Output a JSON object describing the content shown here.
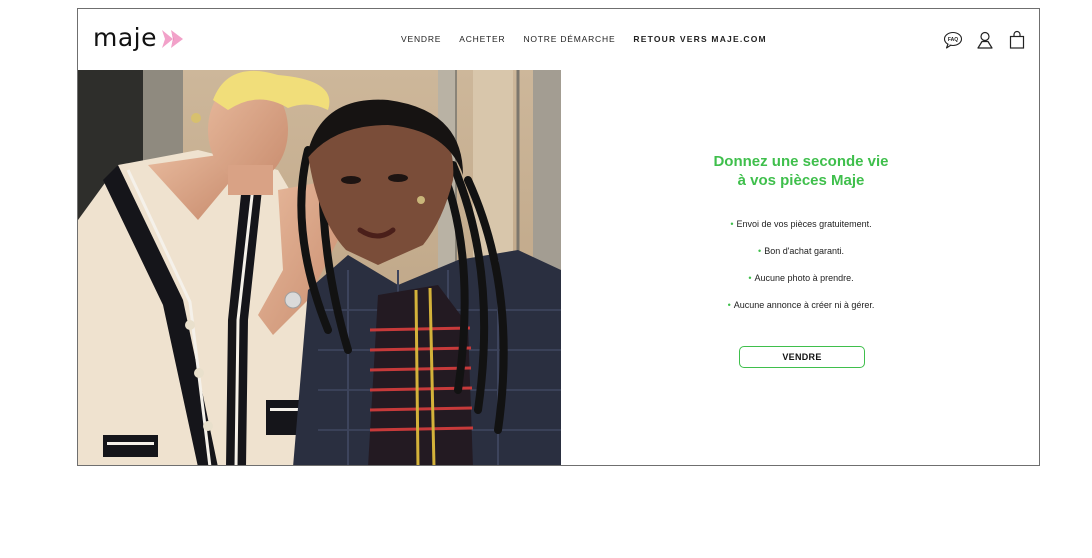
{
  "brand": {
    "name": "maje",
    "accent": "#f2a1c9"
  },
  "nav": [
    {
      "label": "VENDRE"
    },
    {
      "label": "ACHETER"
    },
    {
      "label": "NOTRE DÉMARCHE"
    },
    {
      "label": "RETOUR VERS MAJE.COM"
    }
  ],
  "header_icons": [
    {
      "name": "faq-icon",
      "label": "FAQ"
    },
    {
      "name": "user-icon"
    },
    {
      "name": "bag-icon"
    }
  ],
  "hero": {
    "image": "photo of two people leaning against a stone wall",
    "headline_line1": "Donnez une seconde vie",
    "headline_line2": "à vos pièces Maje",
    "bullets": [
      "Envoi de vos pièces gratuitement.",
      "Bon d'achat garanti.",
      "Aucune photo à prendre.",
      "Aucune annonce à créer ni à gérer."
    ],
    "cta_label": "VENDRE"
  },
  "colors": {
    "accent_green": "#3fbf4c",
    "border": "#6f6f6f"
  }
}
